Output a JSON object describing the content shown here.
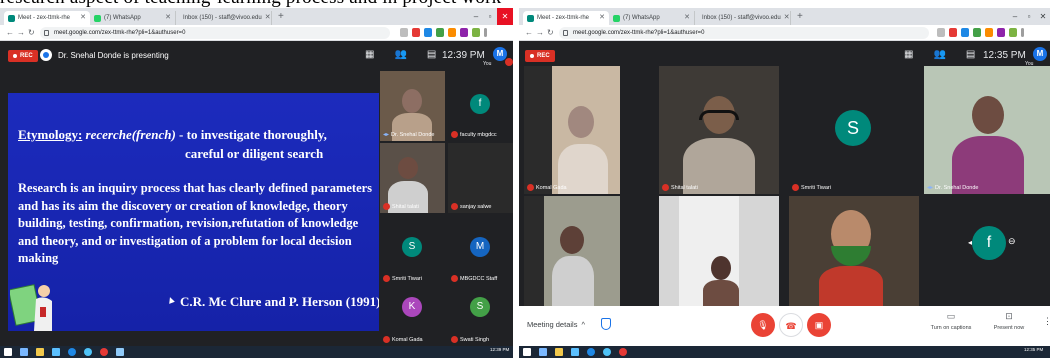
{
  "caption_fragment": "research aspect of teaching-learning process and in project work",
  "left": {
    "tabs": [
      {
        "label": "Meet - zex-ttmk-rhe",
        "icon_color": "#00897b",
        "active": true
      },
      {
        "label": "(7) WhatsApp",
        "icon_color": "#25d366",
        "active": false
      },
      {
        "label": "Inbox (150) - staff@vivoo.edu",
        "icon_color": "#d93025",
        "active": false
      }
    ],
    "url": "meet.google.com/zex-ttmk-rhe?pli=1&authuser=0",
    "rec_label": "REC",
    "presenter_text": "Dr. Snehal Donde is presenting",
    "clock": "12:39 PM",
    "you_initial": "M",
    "you_label": "You",
    "slide": {
      "etymology_label": "Etymology:",
      "etymology_term": "recerche(french)",
      "etymology_rest": " - to investigate thoroughly,",
      "etymology_line2": "careful or diligent search",
      "paragraph": "Research is an inquiry process that has clearly defined parameters  and has its aim the discovery or creation of knowledge, theory building, testing, confirmation, revision,refutation of knowledge and theory, and or investigation of a problem for local decision making",
      "citation": "C.R. Mc Clure and P. Herson (1991)"
    },
    "participants": [
      {
        "name": "Dr. Snehal Donde",
        "initial": "",
        "color": "#4a3b2f"
      },
      {
        "name": "faculty mbgdcc",
        "initial": "f",
        "color": "#00897b"
      },
      {
        "name": "Shital talati",
        "initial": "",
        "color": "#5a5048"
      },
      {
        "name": "sanjay salwe",
        "initial": "",
        "color": "#3a3a3a"
      },
      {
        "name": "Smriti Tiwari",
        "initial": "S",
        "color": "#00897b"
      },
      {
        "name": "MBGDCC Staff",
        "initial": "M",
        "color": "#1565c0"
      },
      {
        "name": "Komal Gada",
        "initial": "K",
        "color": "#ab47bc"
      },
      {
        "name": "Swati Singh",
        "initial": "S",
        "color": "#43a047"
      }
    ]
  },
  "right": {
    "tabs": [
      {
        "label": "Meet - zex-ttmk-rhe",
        "icon_color": "#00897b",
        "active": true
      },
      {
        "label": "(7) WhatsApp",
        "icon_color": "#25d366",
        "active": false
      },
      {
        "label": "Inbox (150) - staff@vivoo.edu",
        "icon_color": "#d93025",
        "active": false
      }
    ],
    "url": "meet.google.com/zex-ttmk-rhe?pli=1&authuser=0",
    "rec_label": "REC",
    "clock": "12:35 PM",
    "you_initial": "M",
    "you_label": "You",
    "participants": [
      {
        "name": "Komal Gada",
        "initial": ""
      },
      {
        "name": "Shital talati",
        "initial": ""
      },
      {
        "name": "Smriti Tiwari",
        "initial": "S",
        "color": "#00897b"
      },
      {
        "name": "Dr. Snehal Donde",
        "initial": ""
      },
      {
        "name": "",
        "initial": ""
      },
      {
        "name": "",
        "initial": ""
      },
      {
        "name": "",
        "initial": ""
      },
      {
        "name": "f",
        "initial": "f",
        "color": "#00897b"
      }
    ],
    "meeting_details": "Meeting details",
    "captions_label": "Turn on captions",
    "present_label": "Present now"
  },
  "taskbar": {
    "time_left": "12:39 PM",
    "time_right": "12:35 PM"
  }
}
